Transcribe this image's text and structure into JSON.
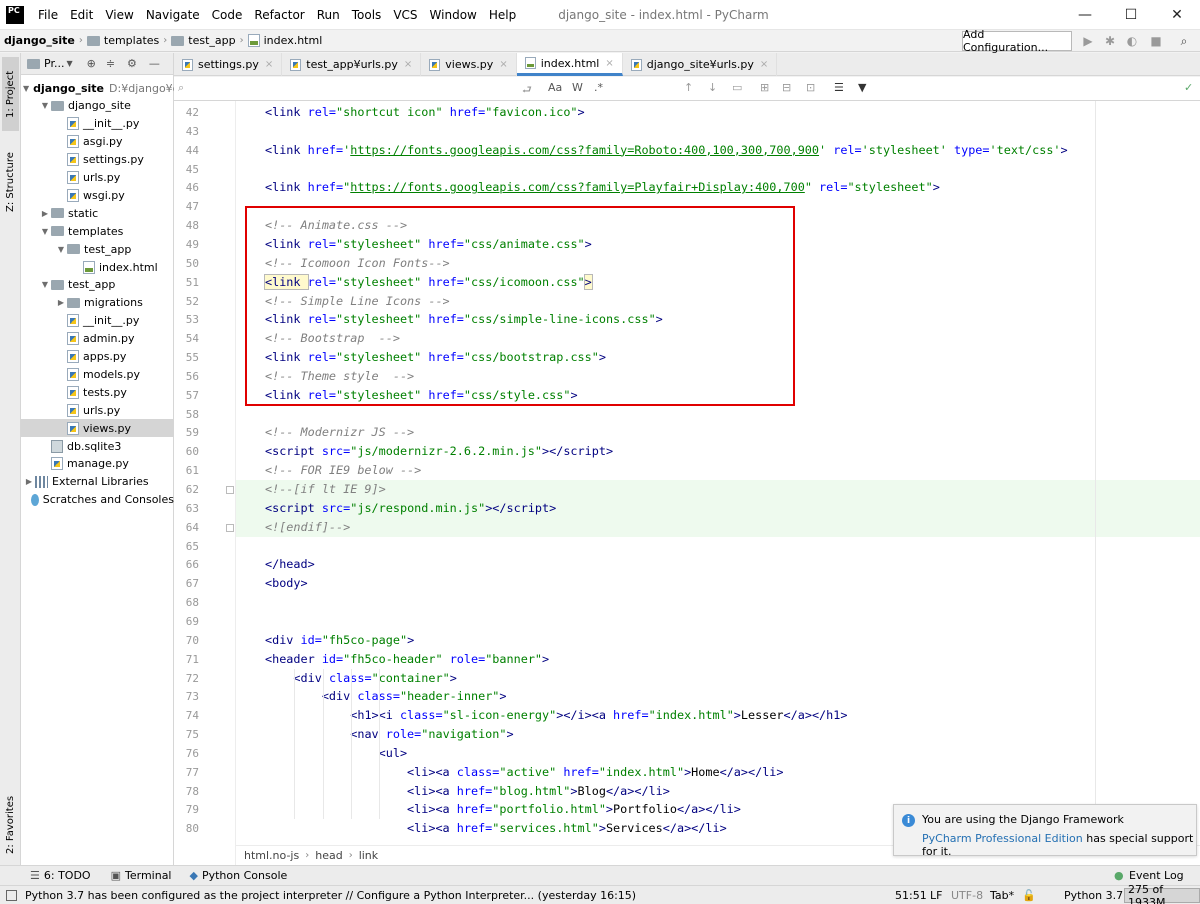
{
  "app": {
    "logo_text": "PC",
    "window_title": "django_site - index.html - PyCharm",
    "menu": [
      "File",
      "Edit",
      "View",
      "Navigate",
      "Code",
      "Refactor",
      "Run",
      "Tools",
      "VCS",
      "Window",
      "Help"
    ]
  },
  "navbar": {
    "breadcrumb": [
      "django_site",
      "templates",
      "test_app",
      "index.html"
    ],
    "add_configuration": "Add Configuration..."
  },
  "side_tabs": {
    "project": "1: Project",
    "structure": "Z: Structure",
    "favorites": "2: Favorites"
  },
  "project_panel": {
    "header": "Pr...",
    "tree": [
      {
        "label": "django_site",
        "extra": "D:¥django¥d",
        "type": "folder",
        "depth": 0,
        "expanded": true,
        "bold": true
      },
      {
        "label": "django_site",
        "type": "folder",
        "depth": 1,
        "expanded": true
      },
      {
        "label": "__init__.py",
        "type": "py",
        "depth": 2
      },
      {
        "label": "asgi.py",
        "type": "py",
        "depth": 2
      },
      {
        "label": "settings.py",
        "type": "py",
        "depth": 2
      },
      {
        "label": "urls.py",
        "type": "py",
        "depth": 2
      },
      {
        "label": "wsgi.py",
        "type": "py",
        "depth": 2
      },
      {
        "label": "static",
        "type": "folder",
        "depth": 1,
        "expanded": false
      },
      {
        "label": "templates",
        "type": "folder",
        "depth": 1,
        "expanded": true
      },
      {
        "label": "test_app",
        "type": "folder",
        "depth": 2,
        "expanded": true
      },
      {
        "label": "index.html",
        "type": "html",
        "depth": 3
      },
      {
        "label": "test_app",
        "type": "folder",
        "depth": 1,
        "expanded": true
      },
      {
        "label": "migrations",
        "type": "folder",
        "depth": 2,
        "expanded": false
      },
      {
        "label": "__init__.py",
        "type": "py",
        "depth": 2
      },
      {
        "label": "admin.py",
        "type": "py",
        "depth": 2
      },
      {
        "label": "apps.py",
        "type": "py",
        "depth": 2
      },
      {
        "label": "models.py",
        "type": "py",
        "depth": 2
      },
      {
        "label": "tests.py",
        "type": "py",
        "depth": 2
      },
      {
        "label": "urls.py",
        "type": "py",
        "depth": 2
      },
      {
        "label": "views.py",
        "type": "py",
        "depth": 2,
        "selected": true
      },
      {
        "label": "db.sqlite3",
        "type": "db",
        "depth": 1
      },
      {
        "label": "manage.py",
        "type": "py",
        "depth": 1
      },
      {
        "label": "External Libraries",
        "type": "lib",
        "depth": 0,
        "expanded": false
      },
      {
        "label": "Scratches and Consoles",
        "type": "scratch",
        "depth": 0
      }
    ]
  },
  "tabs": [
    {
      "label": "settings.py",
      "icon": "py"
    },
    {
      "label": "test_app¥urls.py",
      "icon": "py"
    },
    {
      "label": "views.py",
      "icon": "py"
    },
    {
      "label": "index.html",
      "icon": "html",
      "active": true
    },
    {
      "label": "django_site¥urls.py",
      "icon": "py"
    }
  ],
  "search": {
    "placeholder": "",
    "options": [
      "Aa",
      "W",
      ".*"
    ]
  },
  "editor": {
    "lines": [
      {
        "n": "42",
        "code": [
          [
            "tag",
            "<link "
          ],
          [
            "attr",
            "rel="
          ],
          [
            "val",
            "\"shortcut icon\" "
          ],
          [
            "attr",
            "href="
          ],
          [
            "val",
            "\"favicon.ico\""
          ],
          [
            "tag",
            ">"
          ]
        ]
      },
      {
        "n": "43",
        "code": []
      },
      {
        "n": "44",
        "code": [
          [
            "tag",
            "<link "
          ],
          [
            "attr",
            "href="
          ],
          [
            "val",
            "'"
          ],
          [
            "val-u",
            "https://fonts.googleapis.com/css?family=Roboto:400,100,300,700,900"
          ],
          [
            "val",
            "' "
          ],
          [
            "attr",
            "rel="
          ],
          [
            "val",
            "'stylesheet' "
          ],
          [
            "attr",
            "type="
          ],
          [
            "val",
            "'text/css'"
          ],
          [
            "tag",
            ">"
          ]
        ]
      },
      {
        "n": "45",
        "code": []
      },
      {
        "n": "46",
        "code": [
          [
            "tag",
            "<link "
          ],
          [
            "attr",
            "href="
          ],
          [
            "val",
            "\""
          ],
          [
            "val-u",
            "https://fonts.googleapis.com/css?family=Playfair+Display:400,700"
          ],
          [
            "val",
            "\" "
          ],
          [
            "attr",
            "rel="
          ],
          [
            "val",
            "\"stylesheet\""
          ],
          [
            "tag",
            ">"
          ]
        ]
      },
      {
        "n": "47",
        "code": []
      },
      {
        "n": "48",
        "code": [
          [
            "cmt",
            "<!-- Animate.css -->"
          ]
        ]
      },
      {
        "n": "49",
        "code": [
          [
            "tag",
            "<link "
          ],
          [
            "attr",
            "rel="
          ],
          [
            "val",
            "\"stylesheet\" "
          ],
          [
            "attr",
            "href="
          ],
          [
            "val",
            "\"css/animate.css\""
          ],
          [
            "tag",
            ">"
          ]
        ]
      },
      {
        "n": "50",
        "code": [
          [
            "cmt",
            "<!-- Icomoon Icon Fonts-->"
          ]
        ]
      },
      {
        "n": "51",
        "code": [
          [
            "tag",
            "<link "
          ],
          [
            "attr",
            "rel="
          ],
          [
            "val",
            "\"stylesheet\" "
          ],
          [
            "attr",
            "href="
          ],
          [
            "val",
            "\"css/icomoon.css\""
          ],
          [
            "tag",
            ">"
          ]
        ],
        "current": true
      },
      {
        "n": "52",
        "code": [
          [
            "cmt",
            "<!-- Simple Line Icons -->"
          ]
        ]
      },
      {
        "n": "53",
        "code": [
          [
            "tag",
            "<link "
          ],
          [
            "attr",
            "rel="
          ],
          [
            "val",
            "\"stylesheet\" "
          ],
          [
            "attr",
            "href="
          ],
          [
            "val",
            "\"css/simple-line-icons.css\""
          ],
          [
            "tag",
            ">"
          ]
        ]
      },
      {
        "n": "54",
        "code": [
          [
            "cmt",
            "<!-- Bootstrap  -->"
          ]
        ]
      },
      {
        "n": "55",
        "code": [
          [
            "tag",
            "<link "
          ],
          [
            "attr",
            "rel="
          ],
          [
            "val",
            "\"stylesheet\" "
          ],
          [
            "attr",
            "href="
          ],
          [
            "val",
            "\"css/bootstrap.css\""
          ],
          [
            "tag",
            ">"
          ]
        ]
      },
      {
        "n": "56",
        "code": [
          [
            "cmt",
            "<!-- Theme style  -->"
          ]
        ]
      },
      {
        "n": "57",
        "code": [
          [
            "tag",
            "<link "
          ],
          [
            "attr",
            "rel="
          ],
          [
            "val",
            "\"stylesheet\" "
          ],
          [
            "attr",
            "href="
          ],
          [
            "val",
            "\"css/style.css\""
          ],
          [
            "tag",
            ">"
          ]
        ]
      },
      {
        "n": "58",
        "code": []
      },
      {
        "n": "59",
        "code": [
          [
            "cmt",
            "<!-- Modernizr JS -->"
          ]
        ]
      },
      {
        "n": "60",
        "code": [
          [
            "tag",
            "<script "
          ],
          [
            "attr",
            "src="
          ],
          [
            "val",
            "\"js/modernizr-2.6.2.min.js\""
          ],
          [
            "tag",
            "></"
          ],
          [
            "tag",
            "script"
          ],
          [
            "tag",
            ">"
          ]
        ]
      },
      {
        "n": "61",
        "code": [
          [
            "cmt",
            "<!-- FOR IE9 below -->"
          ]
        ]
      },
      {
        "n": "62",
        "code": [
          [
            "cmt",
            "<!--[if lt IE 9]>"
          ]
        ],
        "green": true
      },
      {
        "n": "63",
        "code": [
          [
            "tag",
            "<script "
          ],
          [
            "attr",
            "src="
          ],
          [
            "val",
            "\"js/respond.min.js\""
          ],
          [
            "tag",
            "></"
          ],
          [
            "tag",
            "script"
          ],
          [
            "tag",
            ">"
          ]
        ],
        "green": true
      },
      {
        "n": "64",
        "code": [
          [
            "cmt",
            "<![endif]-->"
          ]
        ],
        "green": true
      },
      {
        "n": "65",
        "code": []
      },
      {
        "n": "66",
        "code": [
          [
            "tag",
            "</head>"
          ]
        ]
      },
      {
        "n": "67",
        "code": [
          [
            "tag",
            "<body>"
          ]
        ]
      },
      {
        "n": "68",
        "code": []
      },
      {
        "n": "69",
        "code": []
      },
      {
        "n": "70",
        "code": [
          [
            "tag",
            "<div "
          ],
          [
            "attr",
            "id="
          ],
          [
            "val",
            "\"fh5co-page\""
          ],
          [
            "tag",
            ">"
          ]
        ]
      },
      {
        "n": "71",
        "code": [
          [
            "tag",
            "<header "
          ],
          [
            "attr",
            "id="
          ],
          [
            "val",
            "\"fh5co-header\" "
          ],
          [
            "attr",
            "role="
          ],
          [
            "val",
            "\"banner\""
          ],
          [
            "tag",
            ">"
          ]
        ]
      },
      {
        "n": "72",
        "code": [
          [
            "txt",
            "    "
          ],
          [
            "tag",
            "<div "
          ],
          [
            "attr",
            "class="
          ],
          [
            "val",
            "\"container\""
          ],
          [
            "tag",
            ">"
          ]
        ]
      },
      {
        "n": "73",
        "code": [
          [
            "txt",
            "        "
          ],
          [
            "tag",
            "<div "
          ],
          [
            "attr",
            "class="
          ],
          [
            "val",
            "\"header-inner\""
          ],
          [
            "tag",
            ">"
          ]
        ]
      },
      {
        "n": "74",
        "code": [
          [
            "txt",
            "            "
          ],
          [
            "tag",
            "<h1><i "
          ],
          [
            "attr",
            "class="
          ],
          [
            "val",
            "\"sl-icon-energy\""
          ],
          [
            "tag",
            "></i><a "
          ],
          [
            "attr",
            "href="
          ],
          [
            "val",
            "\"index.html\""
          ],
          [
            "tag",
            ">"
          ],
          [
            "txt",
            "Lesser"
          ],
          [
            "tag",
            "</a></h1>"
          ]
        ]
      },
      {
        "n": "75",
        "code": [
          [
            "txt",
            "            "
          ],
          [
            "tag",
            "<nav "
          ],
          [
            "attr",
            "role="
          ],
          [
            "val",
            "\"navigation\""
          ],
          [
            "tag",
            ">"
          ]
        ]
      },
      {
        "n": "76",
        "code": [
          [
            "txt",
            "                "
          ],
          [
            "tag",
            "<ul>"
          ]
        ]
      },
      {
        "n": "77",
        "code": [
          [
            "txt",
            "                    "
          ],
          [
            "tag",
            "<li><a "
          ],
          [
            "attr",
            "class="
          ],
          [
            "val",
            "\"active\" "
          ],
          [
            "attr",
            "href="
          ],
          [
            "val",
            "\"index.html\""
          ],
          [
            "tag",
            ">"
          ],
          [
            "txt",
            "Home"
          ],
          [
            "tag",
            "</a></li>"
          ]
        ]
      },
      {
        "n": "78",
        "code": [
          [
            "txt",
            "                    "
          ],
          [
            "tag",
            "<li><a "
          ],
          [
            "attr",
            "href="
          ],
          [
            "val",
            "\"blog.html\""
          ],
          [
            "tag",
            ">"
          ],
          [
            "txt",
            "Blog"
          ],
          [
            "tag",
            "</a></li>"
          ]
        ]
      },
      {
        "n": "79",
        "code": [
          [
            "txt",
            "                    "
          ],
          [
            "tag",
            "<li><a "
          ],
          [
            "attr",
            "href="
          ],
          [
            "val",
            "\"portfolio.html\""
          ],
          [
            "tag",
            ">"
          ],
          [
            "txt",
            "Portfolio"
          ],
          [
            "tag",
            "</a></li>"
          ]
        ]
      },
      {
        "n": "80",
        "code": [
          [
            "txt",
            "                    "
          ],
          [
            "tag",
            "<li><a "
          ],
          [
            "attr",
            "href="
          ],
          [
            "val",
            "\"services.html\""
          ],
          [
            "tag",
            ">"
          ],
          [
            "txt",
            "Services"
          ],
          [
            "tag",
            "</a></li>"
          ]
        ]
      }
    ]
  },
  "editor_breadcrumb": [
    "html.no-js",
    "head",
    "link"
  ],
  "notification": {
    "title": "You are using the Django Framework",
    "link": "PyCharm Professional Edition",
    "text": " has special support for it."
  },
  "toolstrip": {
    "todo": "6: TODO",
    "terminal": "Terminal",
    "python_console": "Python Console",
    "event_log": "Event Log"
  },
  "status": {
    "message": "Python 3.7 has been configured as the project interpreter // Configure a Python Interpreter... (yesterday 16:15)",
    "position": "51:51",
    "line_sep": "LF",
    "encoding": "UTF-8",
    "indent": "Tab*",
    "interpreter": "Python 3.7",
    "memory": "275 of 1933M"
  },
  "colors": {
    "highlight_box": "#e00000",
    "active_tab_underline": "#4083c9",
    "green_block": "#eefaee"
  }
}
